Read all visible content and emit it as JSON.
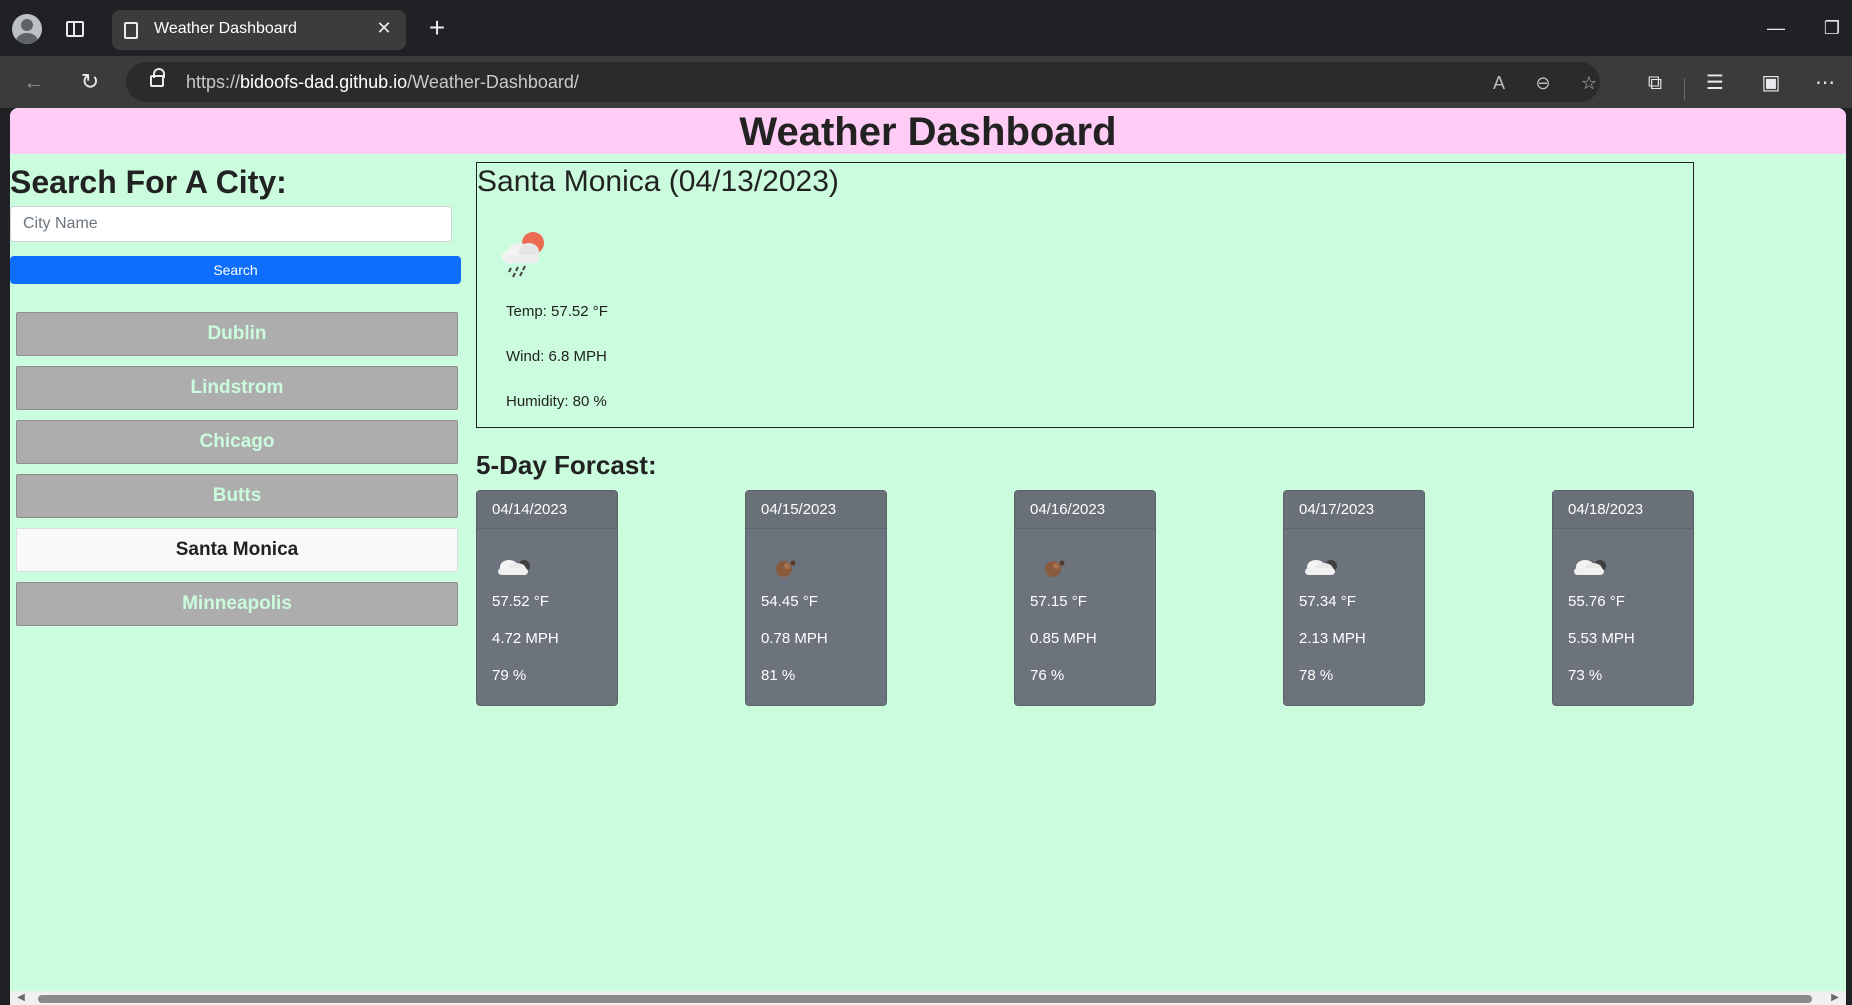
{
  "browser": {
    "tab_title": "Weather Dashboard",
    "url_prefix": "https://",
    "url_host": "bidoofs-dad.github.io",
    "url_path": "/Weather-Dashboard/"
  },
  "page": {
    "title": "Weather Dashboard",
    "colors": {
      "header_bg": "#ffccf5",
      "page_bg": "#cbfcde",
      "search_button": "#0d6efd",
      "card_bg": "#6c737c"
    }
  },
  "search": {
    "heading": "Search For A City:",
    "placeholder": "City Name",
    "value": "",
    "button_label": "Search"
  },
  "history": [
    {
      "label": "Dublin",
      "active": false
    },
    {
      "label": "Lindstrom",
      "active": false
    },
    {
      "label": "Chicago",
      "active": false
    },
    {
      "label": "Butts",
      "active": false
    },
    {
      "label": "Santa Monica",
      "active": true
    },
    {
      "label": "Minneapolis",
      "active": false
    }
  ],
  "current": {
    "title": "Santa Monica (04/13/2023)",
    "icon": "sun-rain-cloud-icon",
    "temp": "Temp: 57.52 °F",
    "wind": "Wind: 6.8 MPH",
    "humidity": "Humidity: 80 %"
  },
  "forecast": {
    "heading": "5-Day Forcast:",
    "days": [
      {
        "date": "04/14/2023",
        "icon": "night-cloud-icon",
        "temp": "57.52 °F",
        "wind": "4.72 MPH",
        "humidity": "79 %"
      },
      {
        "date": "04/15/2023",
        "icon": "moon-icon",
        "temp": "54.45 °F",
        "wind": "0.78 MPH",
        "humidity": "81 %"
      },
      {
        "date": "04/16/2023",
        "icon": "moon-icon",
        "temp": "57.15 °F",
        "wind": "0.85 MPH",
        "humidity": "76 %"
      },
      {
        "date": "04/17/2023",
        "icon": "night-cloud-icon",
        "temp": "57.34 °F",
        "wind": "2.13 MPH",
        "humidity": "78 %"
      },
      {
        "date": "04/18/2023",
        "icon": "night-cloud-icon",
        "temp": "55.76 °F",
        "wind": "5.53 MPH",
        "humidity": "73 %"
      }
    ]
  }
}
